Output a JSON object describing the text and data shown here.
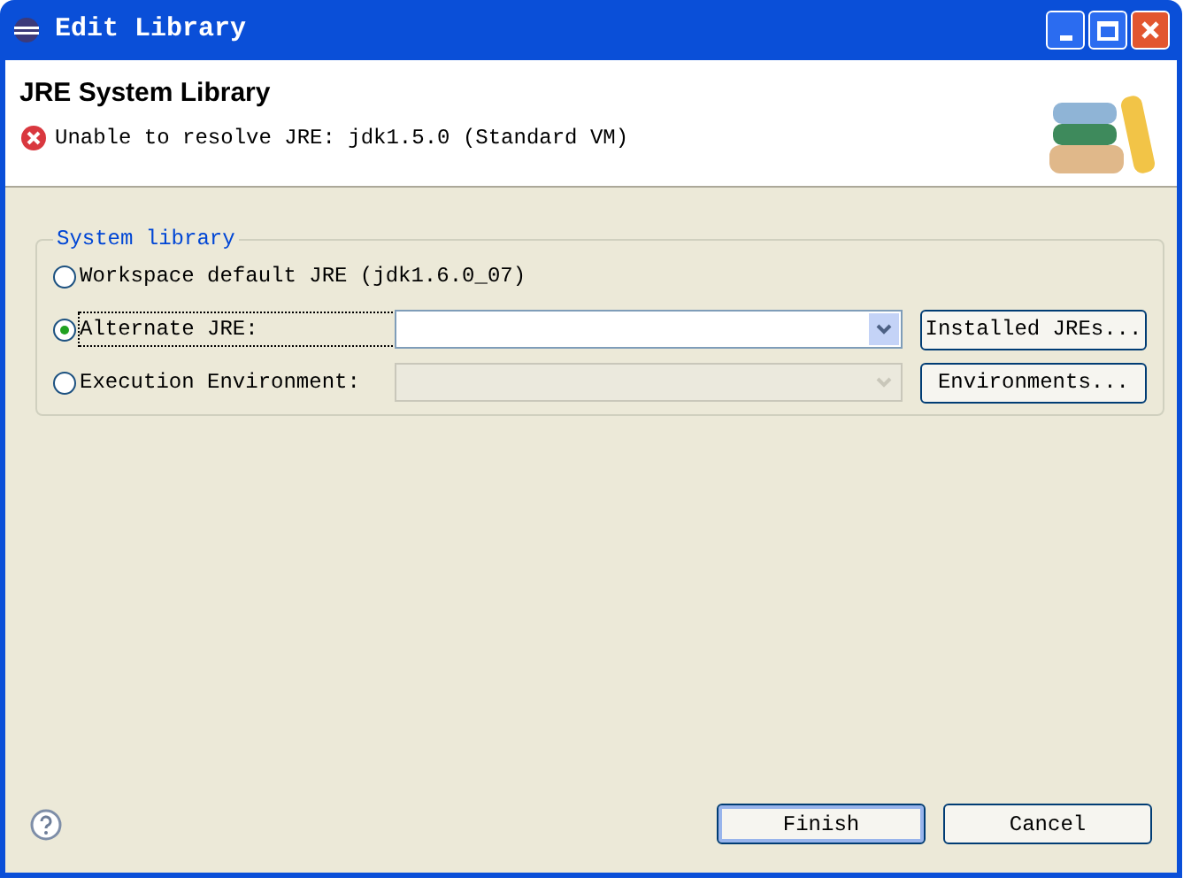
{
  "window": {
    "title": "Edit Library"
  },
  "header": {
    "title": "JRE System Library",
    "error": "Unable to resolve JRE: jdk1.5.0 (Standard VM)"
  },
  "group": {
    "title": "System library",
    "options": [
      {
        "label": "Workspace default JRE (jdk1.6.0_07)",
        "selected": false
      },
      {
        "label": "Alternate JRE:",
        "selected": true,
        "combo": {
          "disabled": false
        },
        "button": "Installed JREs..."
      },
      {
        "label": "Execution Environment:",
        "selected": false,
        "combo": {
          "disabled": true
        },
        "button": "Environments..."
      }
    ]
  },
  "buttons": [
    {
      "label": "Finish",
      "default": true
    },
    {
      "label": "Cancel",
      "default": false
    }
  ]
}
